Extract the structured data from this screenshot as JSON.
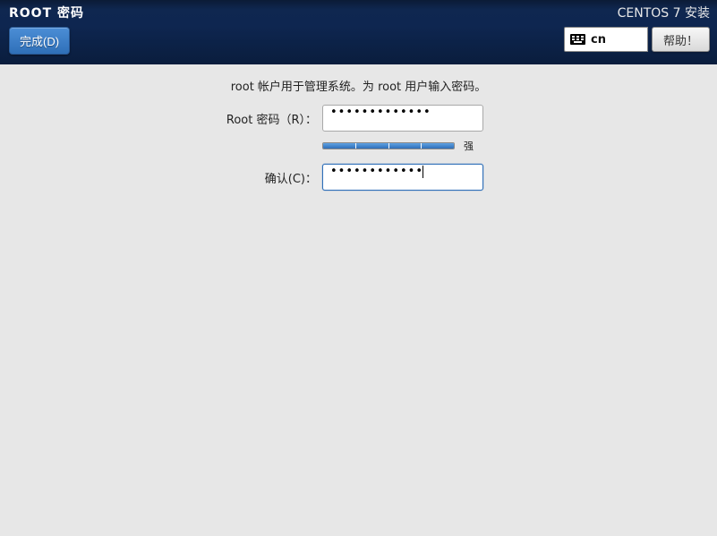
{
  "header": {
    "page_title": "ROOT 密码",
    "done_label": "完成(D)",
    "install_title": "CENTOS 7 安装",
    "keyboard_layout": "cn",
    "help_label": "帮助！"
  },
  "form": {
    "intro": "root 帐户用于管理系统。为 root 用户输入密码。",
    "password_label": "Root 密码（R）：",
    "password_value": "•••••••••••••",
    "confirm_label": "确认(C)：",
    "confirm_value": "••••••••••••",
    "strength_label": "强",
    "strength_segments": 4
  }
}
